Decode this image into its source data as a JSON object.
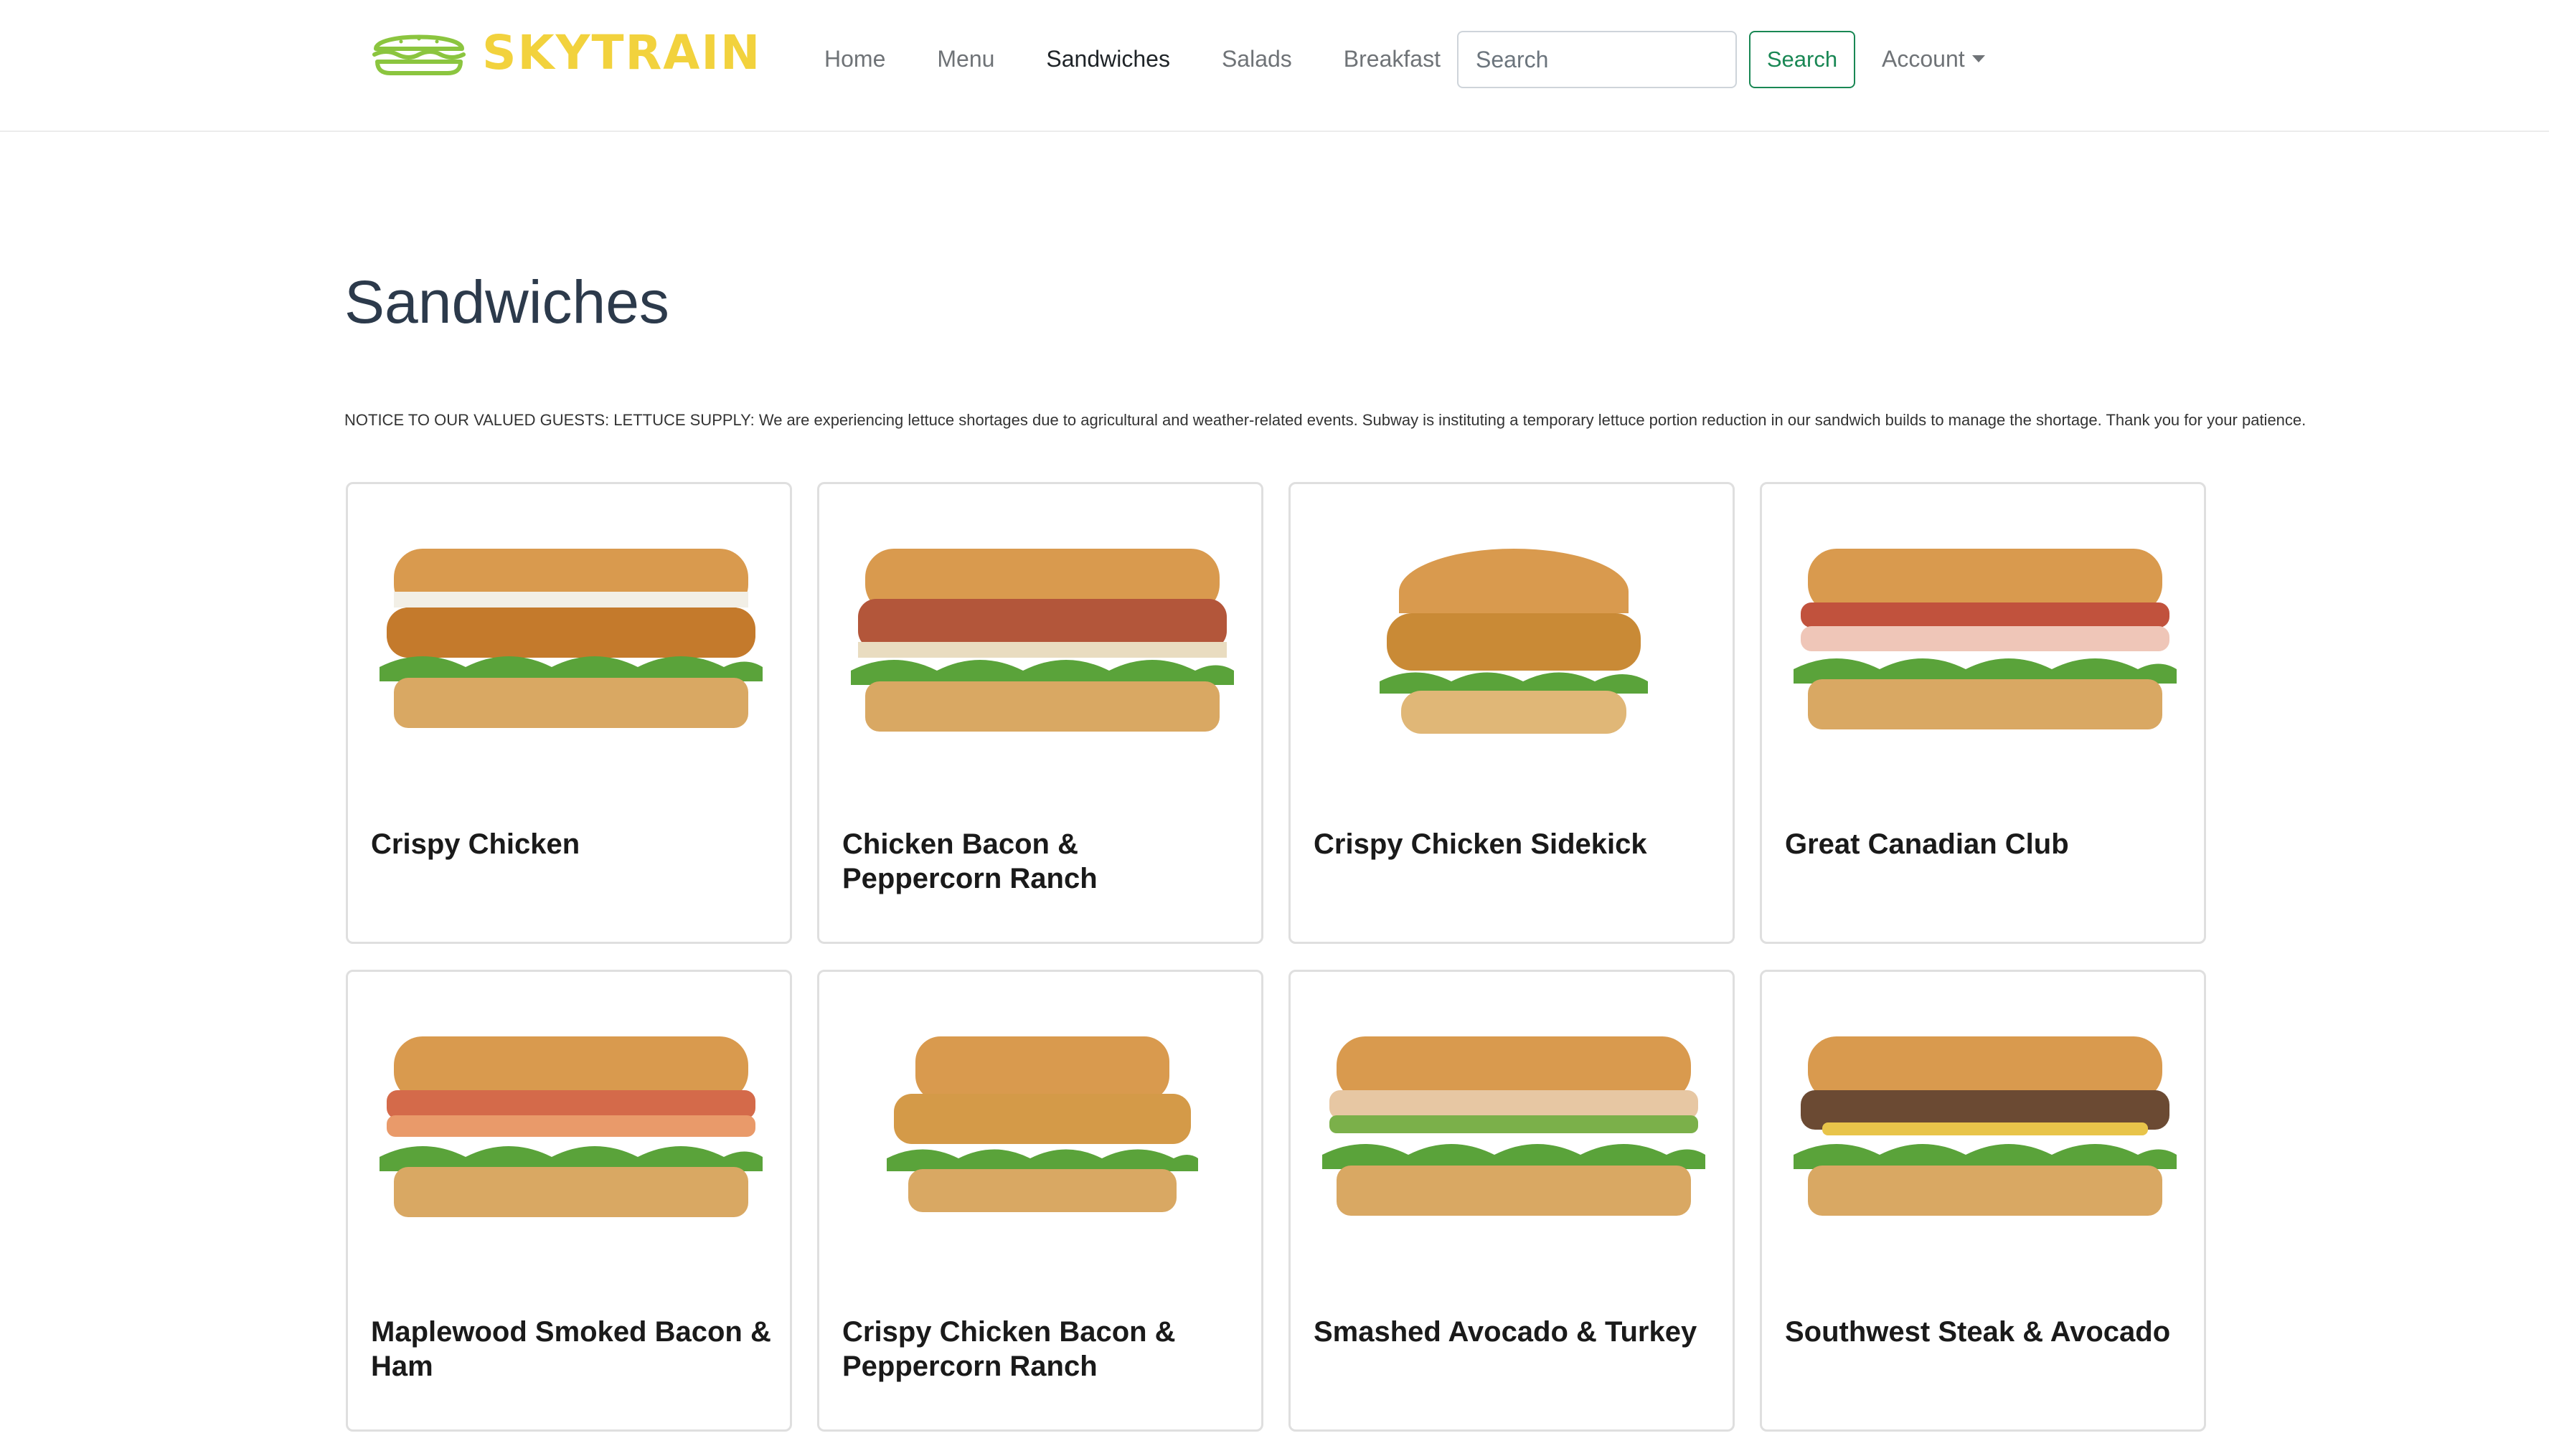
{
  "brand": {
    "name": "SKYTRAIN",
    "logo_icon": "sandwich-logo-icon",
    "brand_color": "#f2d23d",
    "logo_outline_color": "#8bc53f"
  },
  "nav": {
    "links": [
      {
        "label": "Home"
      },
      {
        "label": "Menu"
      },
      {
        "label": "Sandwiches"
      },
      {
        "label": "Salads"
      },
      {
        "label": "Breakfast"
      }
    ],
    "active": "Sandwiches",
    "search": {
      "placeholder": "Search",
      "value": "",
      "button_label": "Search"
    },
    "account_label": "Account"
  },
  "page": {
    "title": "Sandwiches",
    "notice": "NOTICE TO OUR VALUED GUESTS: LETTUCE SUPPLY: We are experiencing lettuce shortages due to agricultural and weather-related events. Subway is instituting a temporary lettuce portion reduction in our sandwich builds to manage the shortage. Thank you for your patience."
  },
  "products": [
    {
      "name": "Crispy Chicken",
      "image": "crispy-chicken-sandwich-image",
      "filling": "#c47a2c"
    },
    {
      "name": "Chicken Bacon & Peppercorn Ranch",
      "image": "chicken-bacon-ranch-sandwich-image",
      "filling": "#b3563a"
    },
    {
      "name": "Crispy Chicken Sidekick",
      "image": "crispy-chicken-sidekick-sandwich-image",
      "filling": "#c98a36"
    },
    {
      "name": "Great Canadian Club",
      "image": "great-canadian-club-sandwich-image",
      "filling": "#c1523d"
    },
    {
      "name": "Maplewood Smoked Bacon & Ham",
      "image": "maplewood-bacon-ham-sandwich-image",
      "filling": "#d46a4a"
    },
    {
      "name": "Crispy Chicken Bacon & Peppercorn Ranch",
      "image": "crispy-chicken-bacon-ranch-sandwich-image",
      "filling": "#d49a48"
    },
    {
      "name": "Smashed Avocado & Turkey",
      "image": "smashed-avocado-turkey-sandwich-image",
      "filling": "#e7c7a3"
    },
    {
      "name": "Southwest Steak & Avocado",
      "image": "southwest-steak-avocado-sandwich-image",
      "filling": "#6b4a33"
    }
  ]
}
